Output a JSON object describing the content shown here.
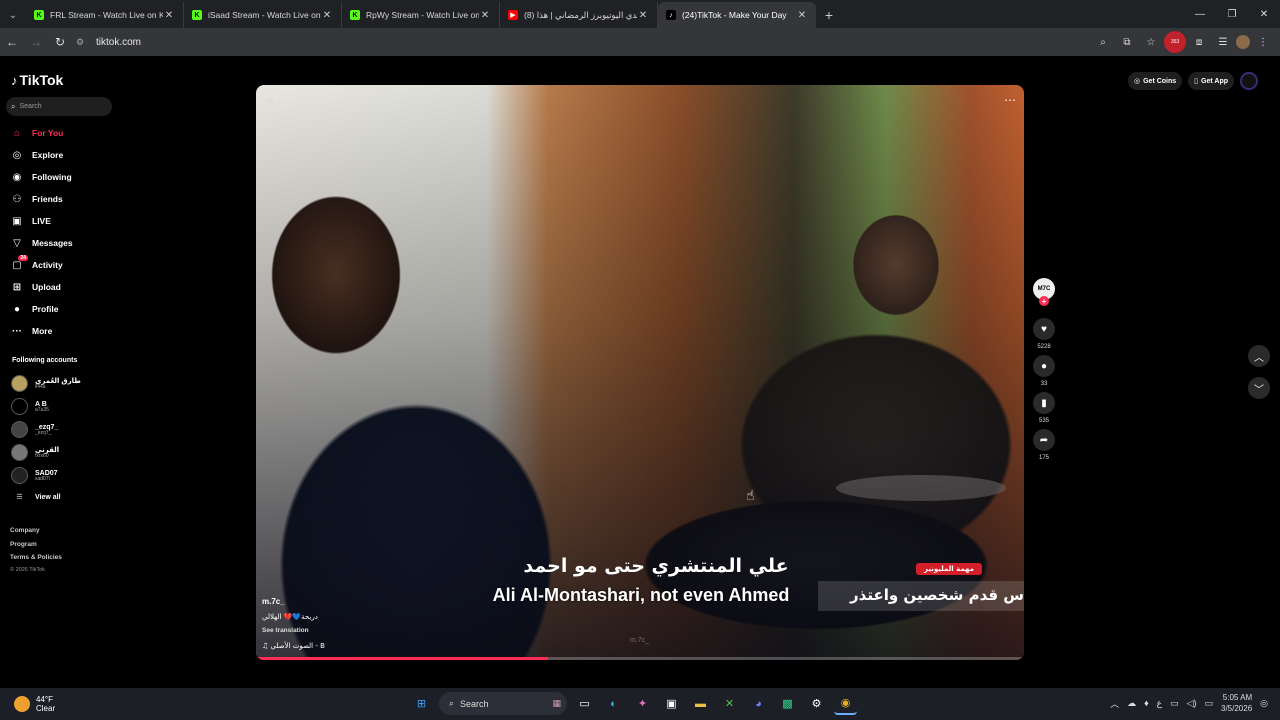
{
  "browser": {
    "tabs": [
      {
        "title": "FRL Stream - Watch Live on Kick",
        "favicon_color": "#53fc18",
        "favicon_letter": "K"
      },
      {
        "title": "iSaad Stream - Watch Live on Kick",
        "favicon_color": "#53fc18",
        "favicon_letter": "K"
      },
      {
        "title": "RpWy Stream - Watch Live on Kick",
        "favicon_color": "#53fc18",
        "favicon_letter": "K"
      },
      {
        "title": "(8) تحدي اليوتيوبرز الرمضاني | هذا",
        "favicon_color": "#ff0000",
        "favicon_letter": "▶"
      },
      {
        "title": "(24)TikTok - Make Your Day",
        "favicon_color": "#000000",
        "favicon_letter": "♪",
        "active": true
      }
    ],
    "url": "tiktok.com",
    "extension_badge": "353"
  },
  "sidebar": {
    "logo": "TikTok",
    "search_placeholder": "Search",
    "menu": [
      {
        "label": "For You",
        "icon": "home-icon",
        "glyph": "⌂",
        "active": true
      },
      {
        "label": "Explore",
        "icon": "compass-icon",
        "glyph": "◎"
      },
      {
        "label": "Following",
        "icon": "following-icon",
        "glyph": "◉"
      },
      {
        "label": "Friends",
        "icon": "friends-icon",
        "glyph": "⚇"
      },
      {
        "label": "LIVE",
        "icon": "live-icon",
        "glyph": "▣"
      },
      {
        "label": "Messages",
        "icon": "messages-icon",
        "glyph": "▽"
      },
      {
        "label": "Activity",
        "icon": "activity-icon",
        "glyph": "▢",
        "badge": "24"
      },
      {
        "label": "Upload",
        "icon": "upload-icon",
        "glyph": "⊞"
      },
      {
        "label": "Profile",
        "icon": "profile-icon",
        "glyph": "●"
      },
      {
        "label": "More",
        "icon": "more-icon",
        "glyph": "···"
      }
    ],
    "following_title": "Following accounts",
    "accounts": [
      {
        "name": "طارق العُمري",
        "user": "ll44a",
        "color": "#b8a060"
      },
      {
        "name": "A B",
        "user": "a7a35",
        "color": "#000000"
      },
      {
        "name": "_ezq7_",
        "user": "_ezq7_",
        "color": "#444444"
      },
      {
        "name": "القرني",
        "user": "fxrs60",
        "color": "#777777"
      },
      {
        "name": "SAD07",
        "user": "sad07l",
        "color": "#222222"
      }
    ],
    "view_all": "View all",
    "footer": {
      "company": "Company",
      "program": "Program",
      "terms": "Terms & Policies",
      "copyright": "© 2026 TikTok"
    }
  },
  "header": {
    "get_coins": "Get Coins",
    "get_app": "Get App"
  },
  "video": {
    "subtitle_ar": "علي المنتشري حتى مو احمد",
    "subtitle_en": "Ali Al-Montashari, not even Ahmed",
    "tag": "مهمة المليونير",
    "banner": "س قدم شخصين واعتذر",
    "author": "m.7c_",
    "caption": "دريحة💙💔 الهلالي",
    "see_translation": "See translation",
    "music": "♫ الصوت الأصلي - B",
    "watermark": "m.7c_",
    "progress": 0.38
  },
  "actions": {
    "creator": "M7C",
    "likes": "5228",
    "comments": "33",
    "saves": "535",
    "shares": "175"
  },
  "taskbar": {
    "temp": "44°F",
    "cond": "Clear",
    "search": "Search",
    "time": "5:05 AM",
    "date": "3/5/2026"
  }
}
